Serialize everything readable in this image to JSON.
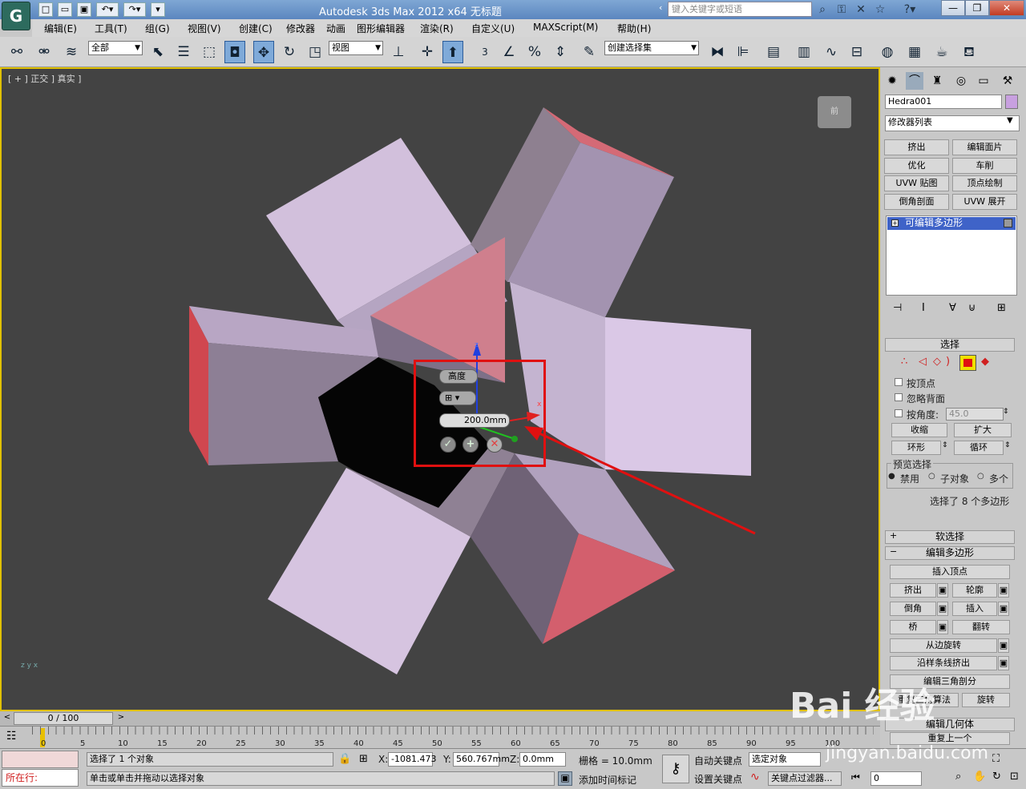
{
  "window": {
    "title": "Autodesk 3ds Max  2012 x64      无标题",
    "search_placeholder": "键入关键字或短语",
    "logo_glyph": "G"
  },
  "menu": [
    "编辑(E)",
    "工具(T)",
    "组(G)",
    "视图(V)",
    "创建(C)",
    "修改器",
    "动画",
    "图形编辑器",
    "渲染(R)",
    "自定义(U)",
    "MAXScript(M)",
    "帮助(H)"
  ],
  "toolbar": {
    "filter_value": "全部",
    "ref_coord_value": "视图",
    "selection_set_value": "创建选择集",
    "snap_label": "3"
  },
  "viewport": {
    "label": "[ + ] 正交 ] 真实 ]",
    "viewcube_label": "前",
    "caddy": {
      "title": "高度",
      "value": "200.0mm"
    },
    "gizmo_z": "z",
    "gizmo_x": "x",
    "axis_tripod": "z y x"
  },
  "command_panel": {
    "object_name": "Hedra001",
    "object_color": "#c8a0e0",
    "modifier_list": "修改器列表",
    "modifier_buttons": [
      "挤出",
      "编辑面片",
      "优化",
      "车削",
      "UVW 贴图",
      "顶点绘制",
      "倒角剖面",
      "UVW 展开"
    ],
    "stack_item": "可编辑多边形",
    "selection_title": "选择",
    "by_vertex": "按顶点",
    "ignore_backface": "忽略背面",
    "by_angle": "按角度:",
    "angle_value": "45.0",
    "shrink": "收缩",
    "grow": "扩大",
    "ring": "环形",
    "loop": "循环",
    "preview_selection": "预览选择",
    "preview_options": [
      "禁用",
      "子对象",
      "多个"
    ],
    "selection_status": "选择了 8 个多边形",
    "soft_selection": "软选择",
    "edit_polygons": "编辑多边形",
    "insert_vertex": "插入顶点",
    "extrude": "挤出",
    "outline": "轮廓",
    "bevel": "倒角",
    "inset": "插入",
    "bridge": "桥",
    "flip": "翻转",
    "hinge_from_edge": "从边旋转",
    "extrude_along_spline": "沿样条线挤出",
    "edit_triangulation": "编辑三角剖分",
    "retriangulate": "重复三角算法",
    "turn": "旋转",
    "edit_geometry": "编辑几何体",
    "repeat_last": "重复上一个"
  },
  "timeline": {
    "frame_display": "0 / 100",
    "ticks": [
      "0",
      "5",
      "10",
      "15",
      "20",
      "25",
      "30",
      "35",
      "40",
      "45",
      "50",
      "55",
      "60",
      "65",
      "70",
      "75",
      "80",
      "85",
      "90",
      "95",
      "100"
    ]
  },
  "status": {
    "selected": "选择了 1 个对象",
    "prompt": "单击或单击并拖动以选择对象",
    "script_label": "所在行:",
    "x_value": "-1081.473",
    "y_value": "560.767mm",
    "z_value": "0.0mm",
    "x_label": "X:",
    "y_label": "Y:",
    "z_label": "Z:",
    "grid": "栅格 = 10.0mm",
    "add_time_tag": "添加时间标记",
    "auto_key": "自动关键点",
    "set_key": "设置关键点",
    "selected_object": "选定对象",
    "key_filters": "关键点过滤器...",
    "frame_value": "0"
  },
  "watermark": {
    "brand": "Bai 经验",
    "url": "jingyan.baidu.com"
  }
}
